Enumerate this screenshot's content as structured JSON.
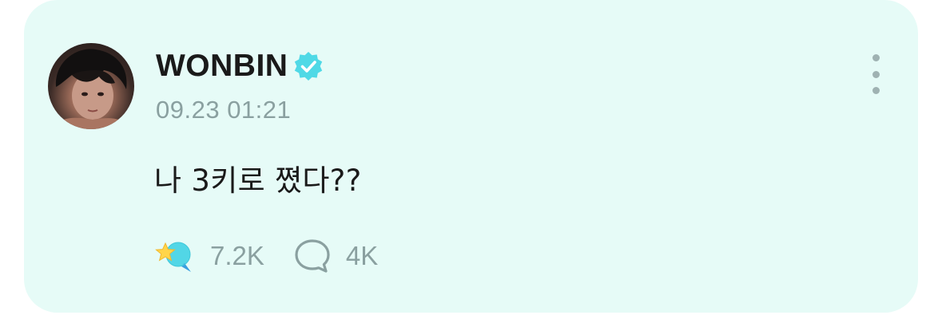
{
  "post": {
    "author": "WONBIN",
    "verified": true,
    "timestamp": "09.23 01:21",
    "text": "나 3키로 쪘다??",
    "reactions": {
      "like_icon": "star-bubble-icon",
      "like_count": "7.2K",
      "comment_icon": "comment-bubble-icon",
      "comment_count": "4K"
    },
    "more_icon": "more-vertical-icon"
  },
  "colors": {
    "card_background": "#e6fbf7",
    "verified_badge": "#4fd9e6",
    "muted_text": "#8aa0a0",
    "primary_text": "#1a1a1a",
    "star": "#ffd54a",
    "bubble": "#52d6e6"
  }
}
